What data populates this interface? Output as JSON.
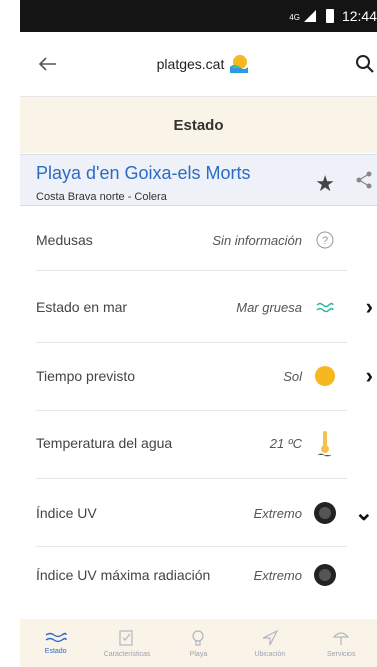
{
  "status_bar": {
    "network": "4G",
    "time": "12:44"
  },
  "app_bar": {
    "logo_text": "platges.cat"
  },
  "section_header": {
    "title": "Estado"
  },
  "beach": {
    "name": "Playa d'en Goixa-els Morts",
    "region": "Costa Brava norte - Colera"
  },
  "rows": [
    {
      "label": "Medusas",
      "value": "Sin información",
      "icon": "help-circle-icon",
      "chevron": ""
    },
    {
      "label": "Estado en mar",
      "value": "Mar gruesa",
      "icon": "waves-icon",
      "chevron": "›"
    },
    {
      "label": "Tiempo previsto",
      "value": "Sol",
      "icon": "sun-icon",
      "chevron": "›"
    },
    {
      "label": "Temperatura del agua",
      "value": "21 ºC",
      "icon": "thermometer-icon",
      "chevron": ""
    },
    {
      "label": "Índice UV",
      "value": "Extremo",
      "icon": "uv-badge-icon",
      "chevron": "⌄"
    },
    {
      "label": "Índice UV máxima radiación",
      "value": "Extremo",
      "icon": "uv-badge-icon",
      "chevron": ""
    }
  ],
  "bottom_nav": [
    {
      "label": "Estado",
      "icon": "waves-icon",
      "active": true
    },
    {
      "label": "Características",
      "icon": "checklist-icon",
      "active": false
    },
    {
      "label": "Playa",
      "icon": "lightbulb-icon",
      "active": false
    },
    {
      "label": "Ubicación",
      "icon": "navigation-icon",
      "active": false
    },
    {
      "label": "Servicios",
      "icon": "umbrella-icon",
      "active": false
    }
  ],
  "colors": {
    "accent": "#2b6cc4",
    "header_bg": "#faf3e7",
    "beach_bg": "#eef1f8",
    "sun": "#f6b81e",
    "wave": "#2bb7a3"
  }
}
